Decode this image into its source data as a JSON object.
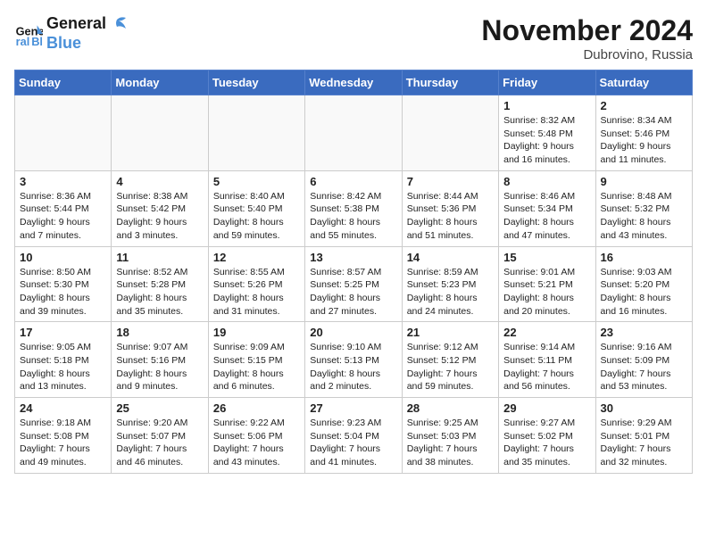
{
  "header": {
    "logo_line1": "General",
    "logo_line2": "Blue",
    "month": "November 2024",
    "location": "Dubrovino, Russia"
  },
  "weekdays": [
    "Sunday",
    "Monday",
    "Tuesday",
    "Wednesday",
    "Thursday",
    "Friday",
    "Saturday"
  ],
  "weeks": [
    [
      {
        "day": "",
        "info": "",
        "empty": true
      },
      {
        "day": "",
        "info": "",
        "empty": true
      },
      {
        "day": "",
        "info": "",
        "empty": true
      },
      {
        "day": "",
        "info": "",
        "empty": true
      },
      {
        "day": "",
        "info": "",
        "empty": true
      },
      {
        "day": "1",
        "info": "Sunrise: 8:32 AM\nSunset: 5:48 PM\nDaylight: 9 hours and 16 minutes."
      },
      {
        "day": "2",
        "info": "Sunrise: 8:34 AM\nSunset: 5:46 PM\nDaylight: 9 hours and 11 minutes."
      }
    ],
    [
      {
        "day": "3",
        "info": "Sunrise: 8:36 AM\nSunset: 5:44 PM\nDaylight: 9 hours and 7 minutes."
      },
      {
        "day": "4",
        "info": "Sunrise: 8:38 AM\nSunset: 5:42 PM\nDaylight: 9 hours and 3 minutes."
      },
      {
        "day": "5",
        "info": "Sunrise: 8:40 AM\nSunset: 5:40 PM\nDaylight: 8 hours and 59 minutes."
      },
      {
        "day": "6",
        "info": "Sunrise: 8:42 AM\nSunset: 5:38 PM\nDaylight: 8 hours and 55 minutes."
      },
      {
        "day": "7",
        "info": "Sunrise: 8:44 AM\nSunset: 5:36 PM\nDaylight: 8 hours and 51 minutes."
      },
      {
        "day": "8",
        "info": "Sunrise: 8:46 AM\nSunset: 5:34 PM\nDaylight: 8 hours and 47 minutes."
      },
      {
        "day": "9",
        "info": "Sunrise: 8:48 AM\nSunset: 5:32 PM\nDaylight: 8 hours and 43 minutes."
      }
    ],
    [
      {
        "day": "10",
        "info": "Sunrise: 8:50 AM\nSunset: 5:30 PM\nDaylight: 8 hours and 39 minutes."
      },
      {
        "day": "11",
        "info": "Sunrise: 8:52 AM\nSunset: 5:28 PM\nDaylight: 8 hours and 35 minutes."
      },
      {
        "day": "12",
        "info": "Sunrise: 8:55 AM\nSunset: 5:26 PM\nDaylight: 8 hours and 31 minutes."
      },
      {
        "day": "13",
        "info": "Sunrise: 8:57 AM\nSunset: 5:25 PM\nDaylight: 8 hours and 27 minutes."
      },
      {
        "day": "14",
        "info": "Sunrise: 8:59 AM\nSunset: 5:23 PM\nDaylight: 8 hours and 24 minutes."
      },
      {
        "day": "15",
        "info": "Sunrise: 9:01 AM\nSunset: 5:21 PM\nDaylight: 8 hours and 20 minutes."
      },
      {
        "day": "16",
        "info": "Sunrise: 9:03 AM\nSunset: 5:20 PM\nDaylight: 8 hours and 16 minutes."
      }
    ],
    [
      {
        "day": "17",
        "info": "Sunrise: 9:05 AM\nSunset: 5:18 PM\nDaylight: 8 hours and 13 minutes."
      },
      {
        "day": "18",
        "info": "Sunrise: 9:07 AM\nSunset: 5:16 PM\nDaylight: 8 hours and 9 minutes."
      },
      {
        "day": "19",
        "info": "Sunrise: 9:09 AM\nSunset: 5:15 PM\nDaylight: 8 hours and 6 minutes."
      },
      {
        "day": "20",
        "info": "Sunrise: 9:10 AM\nSunset: 5:13 PM\nDaylight: 8 hours and 2 minutes."
      },
      {
        "day": "21",
        "info": "Sunrise: 9:12 AM\nSunset: 5:12 PM\nDaylight: 7 hours and 59 minutes."
      },
      {
        "day": "22",
        "info": "Sunrise: 9:14 AM\nSunset: 5:11 PM\nDaylight: 7 hours and 56 minutes."
      },
      {
        "day": "23",
        "info": "Sunrise: 9:16 AM\nSunset: 5:09 PM\nDaylight: 7 hours and 53 minutes."
      }
    ],
    [
      {
        "day": "24",
        "info": "Sunrise: 9:18 AM\nSunset: 5:08 PM\nDaylight: 7 hours and 49 minutes."
      },
      {
        "day": "25",
        "info": "Sunrise: 9:20 AM\nSunset: 5:07 PM\nDaylight: 7 hours and 46 minutes."
      },
      {
        "day": "26",
        "info": "Sunrise: 9:22 AM\nSunset: 5:06 PM\nDaylight: 7 hours and 43 minutes."
      },
      {
        "day": "27",
        "info": "Sunrise: 9:23 AM\nSunset: 5:04 PM\nDaylight: 7 hours and 41 minutes."
      },
      {
        "day": "28",
        "info": "Sunrise: 9:25 AM\nSunset: 5:03 PM\nDaylight: 7 hours and 38 minutes."
      },
      {
        "day": "29",
        "info": "Sunrise: 9:27 AM\nSunset: 5:02 PM\nDaylight: 7 hours and 35 minutes."
      },
      {
        "day": "30",
        "info": "Sunrise: 9:29 AM\nSunset: 5:01 PM\nDaylight: 7 hours and 32 minutes."
      }
    ]
  ]
}
